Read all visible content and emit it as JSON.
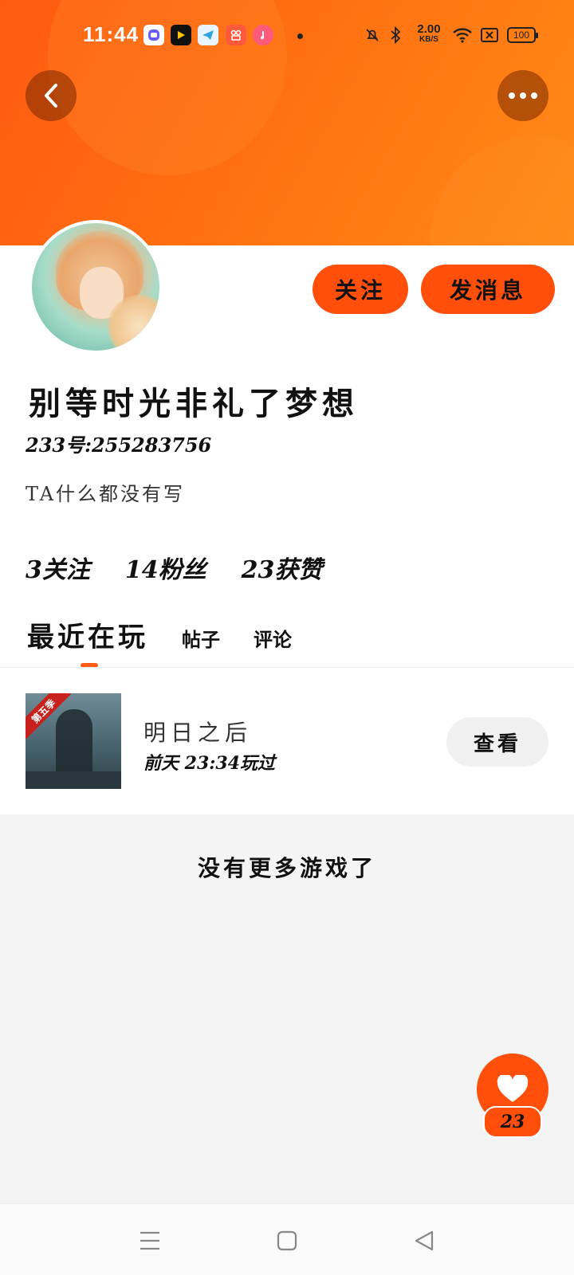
{
  "status_bar": {
    "time": "11:44",
    "net_speed_value": "2.00",
    "net_speed_unit": "KB/S",
    "battery": "100",
    "icons": [
      "chat-app-icon",
      "media-app-icon",
      "telegram-icon",
      "app-store-icon",
      "music-icon",
      "mute-bell-icon",
      "bluetooth-icon",
      "wifi-icon",
      "sim-off-icon",
      "battery-icon"
    ]
  },
  "header": {
    "back_icon": "chevron-left-icon",
    "more_icon": "more-dots-icon"
  },
  "profile": {
    "follow_label": "关注",
    "message_label": "发消息",
    "name": "别等时光非礼了梦想",
    "id_text": "233号:255283756",
    "bio": "TA什么都没有写",
    "stats": {
      "following": "3关注",
      "followers": "14粉丝",
      "likes": "23获赞"
    }
  },
  "tabs": [
    {
      "label": "最近在玩",
      "active": true
    },
    {
      "label": "帖子",
      "active": false
    },
    {
      "label": "评论",
      "active": false
    }
  ],
  "games": [
    {
      "badge": "第五季",
      "title": "明日之后",
      "played": "前天 23:34玩过",
      "button_label": "查看"
    }
  ],
  "empty_text": "没有更多游戏了",
  "like_fab": {
    "icon": "heart-icon",
    "count": "23"
  },
  "nav": {
    "icons": [
      "menu-icon",
      "home-square-icon",
      "back-triangle-icon"
    ]
  },
  "colors": {
    "accent": "#ff5a12",
    "button": "#ff4f0a",
    "background_gray": "#f4f4f4"
  }
}
